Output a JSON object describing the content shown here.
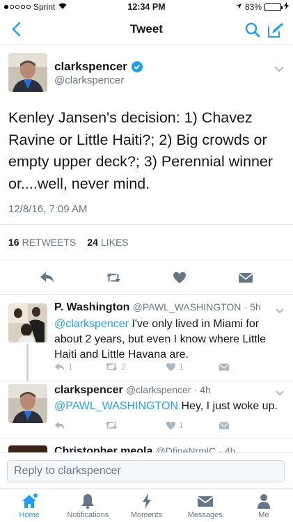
{
  "status_bar": {
    "carrier": "Sprint",
    "time": "12:34 PM",
    "battery": "83%",
    "battery_level": 0.83
  },
  "nav": {
    "title": "Tweet"
  },
  "main_tweet": {
    "name": "clarkspencer",
    "handle": "@clarkspencer",
    "text": "Kenley Jansen's decision: 1) Chavez Ravine or Little Haiti?; 2) Big crowds or empty upper deck?; 3) Perennial winner or....well, never mind.",
    "date": "12/8/16, 7:09 AM",
    "retweets_count": "16",
    "retweets_label": "RETWEETS",
    "likes_count": "24",
    "likes_label": "LIKES"
  },
  "replies": [
    {
      "name": "P. Washington",
      "handle": "@PAWL_WASHINGTON",
      "time": "· 5h",
      "mention": "@clarkspencer",
      "text": " I've only lived in Miami for about 2 years, but even I know where Little Haiti and Little Havana are.",
      "reply_count": "1",
      "retweet_count": "2",
      "like_count": "1"
    },
    {
      "name": "clarkspencer",
      "handle": "@clarkspencer",
      "time": "· 4h",
      "mention": "@PAWL_WASHINGTON",
      "text": " Hey, I just woke up.",
      "reply_count": "",
      "retweet_count": "",
      "like_count": "1"
    },
    {
      "name": "Christopher meola",
      "handle": "@DfineNrmlC",
      "time": "· 4h"
    }
  ],
  "reply_bar": {
    "placeholder": "Reply to clarkspencer"
  },
  "tabs": [
    {
      "label": "Home",
      "icon": "home-icon",
      "active": true
    },
    {
      "label": "Notifications",
      "icon": "bell-icon",
      "active": false
    },
    {
      "label": "Moments",
      "icon": "lightning-icon",
      "active": false
    },
    {
      "label": "Messages",
      "icon": "envelope-icon",
      "active": false
    },
    {
      "label": "Me",
      "icon": "person-icon",
      "active": false
    }
  ],
  "colors": {
    "accent": "#1da1f2",
    "muted": "#657786",
    "icon_muted": "#aab8c2"
  }
}
